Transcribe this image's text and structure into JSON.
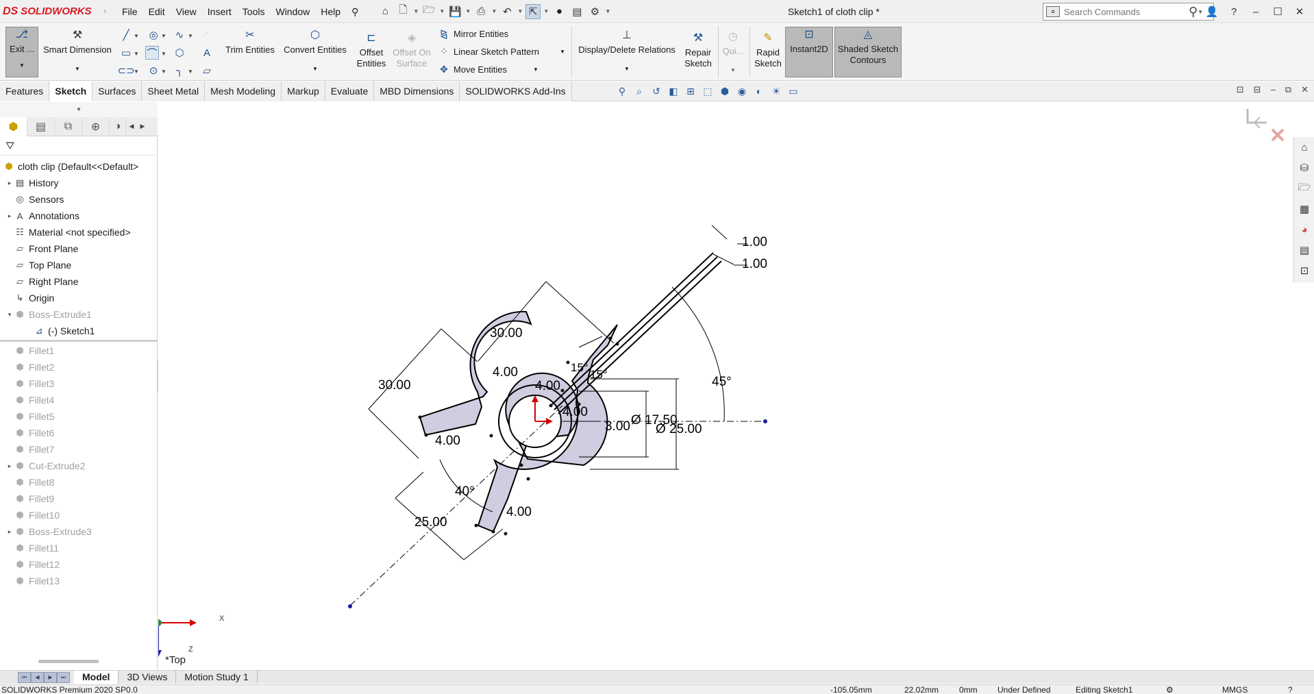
{
  "app": {
    "brand": "SOLIDWORKS",
    "brand_prefix": "DS",
    "document_title": "Sketch1 of cloth clip *",
    "menu": [
      "File",
      "Edit",
      "View",
      "Insert",
      "Tools",
      "Window",
      "Help"
    ],
    "search_placeholder": "Search Commands",
    "window_buttons": [
      "?",
      "–",
      "☐",
      "✕"
    ]
  },
  "command_manager": {
    "exit_sketch": "Exit ...",
    "smart_dimension": "Smart Dimension",
    "trim_entities": "Trim Entities",
    "convert_entities": "Convert Entities",
    "offset_entities_1": "Offset",
    "offset_entities_2": "Entities",
    "offset_on_surface_1": "Offset On",
    "offset_on_surface_2": "Surface",
    "mirror_entities": "Mirror Entities",
    "linear_sketch_pattern": "Linear Sketch Pattern",
    "move_entities": "Move Entities",
    "display_delete_relations": "Display/Delete Relations",
    "repair_sketch_1": "Repair",
    "repair_sketch_2": "Sketch",
    "quick_snaps": "Qui...",
    "rapid_sketch_1": "Rapid",
    "rapid_sketch_2": "Sketch",
    "instant2d": "Instant2D",
    "shaded_contours_1": "Shaded Sketch",
    "shaded_contours_2": "Contours"
  },
  "command_tabs": [
    "Features",
    "Sketch",
    "Surfaces",
    "Sheet Metal",
    "Mesh Modeling",
    "Markup",
    "Evaluate",
    "MBD Dimensions",
    "SOLIDWORKS Add-Ins"
  ],
  "active_command_tab": "Sketch",
  "feature_tree": {
    "root": "cloth clip  (Default<<Default>",
    "items": [
      {
        "label": "History"
      },
      {
        "label": "Sensors"
      },
      {
        "label": "Annotations"
      },
      {
        "label": "Material <not specified>"
      },
      {
        "label": "Front Plane"
      },
      {
        "label": "Top Plane"
      },
      {
        "label": "Right Plane"
      },
      {
        "label": "Origin"
      },
      {
        "label": "Boss-Extrude1"
      },
      {
        "label": "(-) Sketch1"
      },
      {
        "label": "Fillet1"
      },
      {
        "label": "Fillet2"
      },
      {
        "label": "Fillet3"
      },
      {
        "label": "Fillet4"
      },
      {
        "label": "Fillet5"
      },
      {
        "label": "Fillet6"
      },
      {
        "label": "Fillet7"
      },
      {
        "label": "Cut-Extrude2"
      },
      {
        "label": "Fillet8"
      },
      {
        "label": "Fillet9"
      },
      {
        "label": "Fillet10"
      },
      {
        "label": "Boss-Extrude3"
      },
      {
        "label": "Fillet11"
      },
      {
        "label": "Fillet12"
      },
      {
        "label": "Fillet13"
      }
    ]
  },
  "graphics": {
    "view_name": "*Top",
    "triad_x": "X",
    "triad_z": "Z",
    "dimensions": {
      "d1": "1.00",
      "d2": "1.00",
      "d3": "30.00",
      "d4": "30.00",
      "d5": "45°",
      "d6": "4.00",
      "d7": "15°",
      "d8": "15°",
      "d9": "4.00",
      "d10": "4.00",
      "d11": "3.00",
      "d12": "Ø 17.50",
      "d13": "Ø 25.00",
      "d14": "4.00",
      "d15": "40°",
      "d16": "4.00",
      "d17": "25.00"
    },
    "sketch_fill": "#cfcde0",
    "dimension_color": "#000000"
  },
  "bottom_tabs": [
    "Model",
    "3D Views",
    "Motion Study 1"
  ],
  "active_bottom_tab": "Model",
  "status": {
    "product": "SOLIDWORKS Premium 2020 SP0.0",
    "x": "-105.05mm",
    "y": "22.02mm",
    "z": "0mm",
    "state": "Under Defined",
    "editing": "Editing Sketch1",
    "units": "MMGS"
  }
}
